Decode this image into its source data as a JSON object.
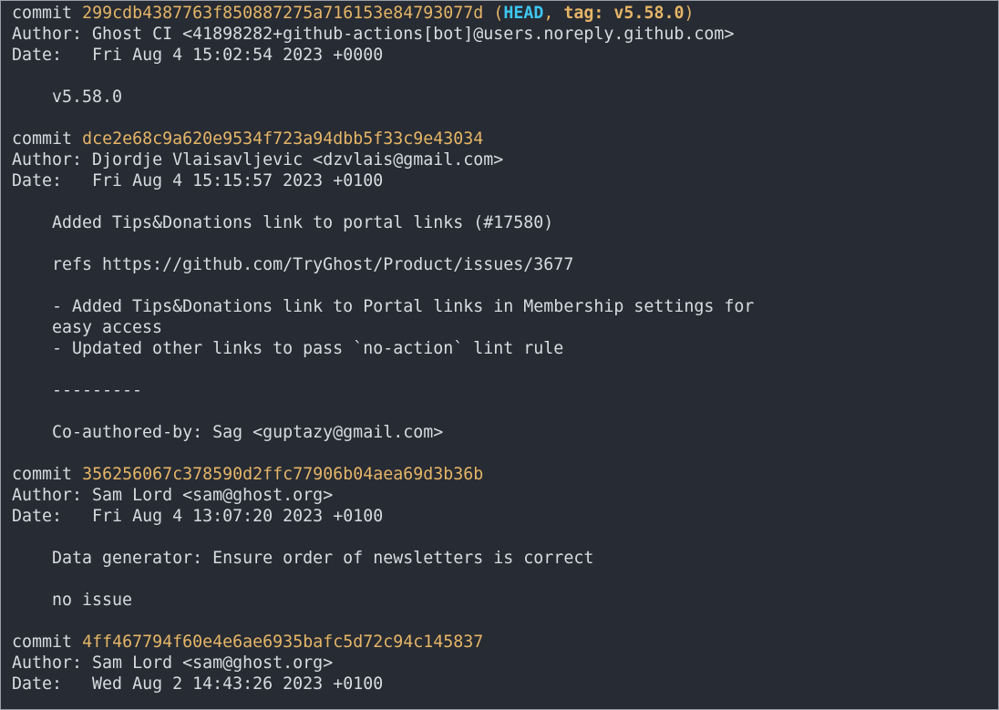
{
  "colors": {
    "background": "#272b33",
    "text": "#d8dbe0",
    "commit_hash": "#e5b567",
    "head_ref": "#3ec6f0"
  },
  "commits": [
    {
      "commit_word": "commit",
      "hash": "299cdb4387763f850887275a716153e84793077d",
      "refs_open": "(",
      "head": "HEAD",
      "refs_sep": ", ",
      "tag": "tag: v5.58.0",
      "refs_close": ")",
      "author_line": "Author: Ghost CI <41898282+github-actions[bot]@users.noreply.github.com>",
      "date_line": "Date:   Fri Aug 4 15:02:54 2023 +0000",
      "message": [
        "v5.58.0"
      ]
    },
    {
      "commit_word": "commit",
      "hash": "dce2e68c9a620e9534f723a94dbb5f33c9e43034",
      "author_line": "Author: Djordje Vlaisavljevic <dzvlais@gmail.com>",
      "date_line": "Date:   Fri Aug 4 15:15:57 2023 +0100",
      "message": [
        "Added Tips&Donations link to portal links (#17580)",
        "",
        "refs https://github.com/TryGhost/Product/issues/3677",
        "",
        "- Added Tips&Donations link to Portal links in Membership settings for",
        "easy access",
        "- Updated other links to pass `no-action` lint rule",
        "",
        "---------",
        "",
        "Co-authored-by: Sag <guptazy@gmail.com>"
      ]
    },
    {
      "commit_word": "commit",
      "hash": "356256067c378590d2ffc77906b04aea69d3b36b",
      "author_line": "Author: Sam Lord <sam@ghost.org>",
      "date_line": "Date:   Fri Aug 4 13:07:20 2023 +0100",
      "message": [
        "Data generator: Ensure order of newsletters is correct",
        "",
        "no issue"
      ]
    },
    {
      "commit_word": "commit",
      "hash": "4ff467794f60e4e6ae6935bafc5d72c94c145837",
      "author_line": "Author: Sam Lord <sam@ghost.org>",
      "date_line": "Date:   Wed Aug 2 14:43:26 2023 +0100"
    }
  ]
}
